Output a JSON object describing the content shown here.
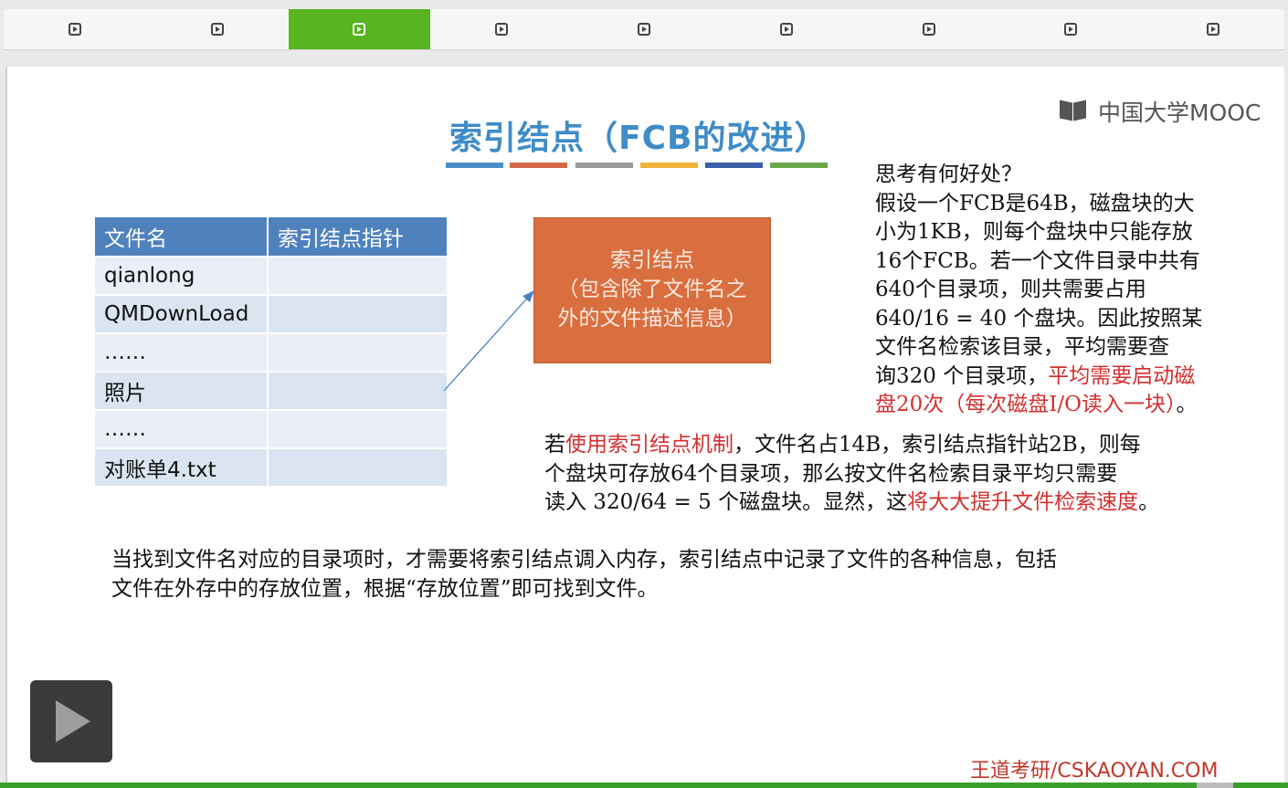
{
  "tabs": [
    {
      "icon": "play-square-icon",
      "active": false
    },
    {
      "icon": "play-square-icon",
      "active": false
    },
    {
      "icon": "play-square-icon",
      "active": true
    },
    {
      "icon": "play-square-icon",
      "active": false
    },
    {
      "icon": "play-square-icon",
      "active": false
    },
    {
      "icon": "play-square-icon",
      "active": false
    },
    {
      "icon": "play-square-icon",
      "active": false
    },
    {
      "icon": "play-square-icon",
      "active": false
    },
    {
      "icon": "play-square-icon",
      "active": false
    }
  ],
  "colors": {
    "active_tab": "#58b41f",
    "title": "#3f8cc7",
    "accent_red": "#d32f2f",
    "index_box": "#d96e3f",
    "table_header": "#4f81bd"
  },
  "logo": {
    "text": "中国大学MOOC"
  },
  "slide": {
    "title": "索引结点（FCB的改进）",
    "title_bar_colors": [
      "#4a90c8",
      "#d4694a",
      "#9a9a9a",
      "#f0b33a",
      "#3a5fa8",
      "#6aa64a"
    ],
    "table": {
      "headers": [
        "文件名",
        "索引结点指针"
      ],
      "rows": [
        "qianlong",
        "QMDownLoad",
        "……",
        "照片",
        "……",
        "对账单4.txt"
      ]
    },
    "index_node": {
      "line1": "索引结点",
      "line2": "（包含除了文件名之",
      "line3": "外的文件描述信息）"
    },
    "right": {
      "l1": "思考有何好处？",
      "l2": "假设一个FCB是64B，磁盘块的大",
      "l3": "小为1KB，则每个盘块中只能存放",
      "l4": "16个FCB。若一个文件目录中共有",
      "l5": "640个目录项，则共需要占用",
      "l6": "640/16 = 40 个盘块。因此按照某",
      "l7": "文件名检索该目录，平均需要查",
      "l8a": "询320 个目录项，",
      "l8b": "平均需要启动磁",
      "l9a": "盘20次（每次磁盘I/O读入一块）",
      "l9b": "。"
    },
    "middle": {
      "a1": "若",
      "a2": "使用索引结点机制",
      "a3": "，文件名占14B，索引结点指针站2B，则每",
      "b": "个盘块可存放64个目录项，那么按文件名检索目录平均只需要",
      "c1": "读入 320/64 = 5 个磁盘块。显然，这",
      "c2": "将大大提升文件检索速度",
      "c3": "。"
    },
    "bottom": {
      "l1": "当找到文件名对应的目录项时，才需要将索引结点调入内存，索引结点中记录了文件的各种信息，包括",
      "l2": "文件在外存中的存放位置，根据“存放位置”即可找到文件。"
    },
    "watermark": "王道考研/CSKAOYAN.COM"
  },
  "player": {
    "icon": "play-icon"
  }
}
